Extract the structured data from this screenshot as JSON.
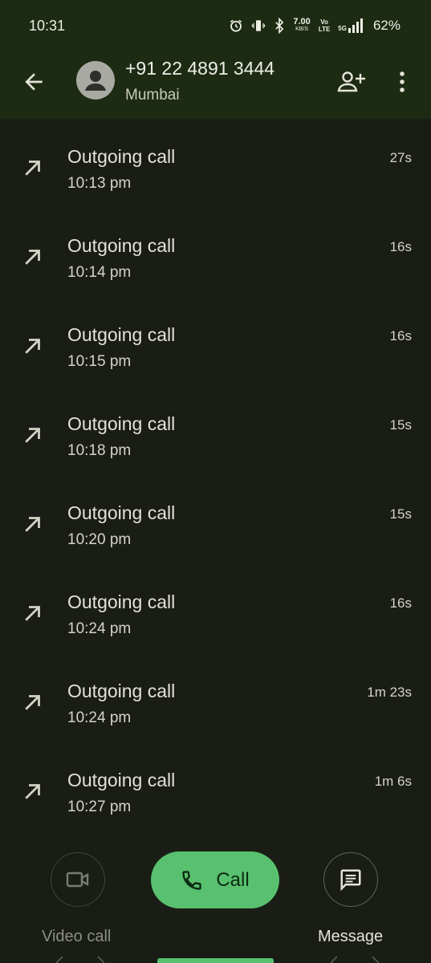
{
  "status_bar": {
    "time": "10:31",
    "net_speed_value": "7.00",
    "net_speed_unit": "KB/S",
    "volte_top": "Vo",
    "volte_bottom": "LTE",
    "network": "5G",
    "battery": "62%"
  },
  "header": {
    "number": "+91 22 4891 3444",
    "location": "Mumbai"
  },
  "calls": [
    {
      "type": "Outgoing call",
      "time": "10:13 pm",
      "duration": "27s"
    },
    {
      "type": "Outgoing call",
      "time": "10:14 pm",
      "duration": "16s"
    },
    {
      "type": "Outgoing call",
      "time": "10:15 pm",
      "duration": "16s"
    },
    {
      "type": "Outgoing call",
      "time": "10:18 pm",
      "duration": "15s"
    },
    {
      "type": "Outgoing call",
      "time": "10:20 pm",
      "duration": "15s"
    },
    {
      "type": "Outgoing call",
      "time": "10:24 pm",
      "duration": "16s"
    },
    {
      "type": "Outgoing call",
      "time": "10:24 pm",
      "duration": "1m 23s"
    },
    {
      "type": "Outgoing call",
      "time": "10:27 pm",
      "duration": "1m 6s"
    }
  ],
  "actions": {
    "video_label": "Video call",
    "call_label": "Call",
    "message_label": "Message"
  },
  "icons": {
    "back": "back-arrow-icon",
    "avatar": "person-icon",
    "add_contact": "add-person-icon",
    "more": "more-vert-icon",
    "outgoing": "outgoing-arrow-icon",
    "video": "videocam-icon",
    "phone": "phone-icon",
    "message": "message-icon"
  },
  "colors": {
    "header_bg": "#1e2b13",
    "page_bg": "#1a1d16",
    "call_button": "#58c06e"
  }
}
